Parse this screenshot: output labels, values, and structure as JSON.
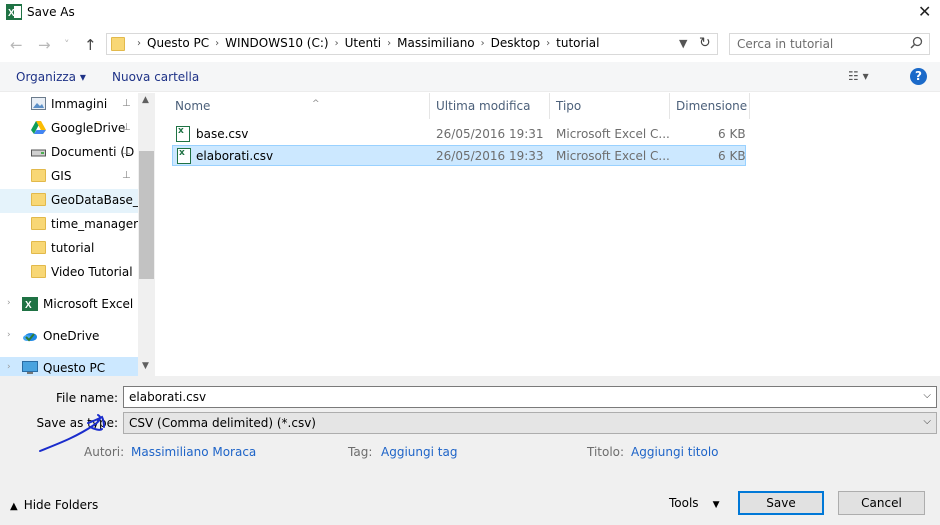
{
  "window": {
    "title": "Save As",
    "close_glyph": "✕"
  },
  "nav": {
    "back_glyph": "←",
    "forward_glyph": "→",
    "recent_glyph": "˅",
    "up_glyph": "↑",
    "breadcrumbs": [
      "Questo PC",
      "WINDOWS10 (C:)",
      "Utenti",
      "Massimiliano",
      "Desktop",
      "tutorial"
    ],
    "search_placeholder": "Cerca in tutorial"
  },
  "toolbar": {
    "organize_label": "Organizza ▾",
    "new_folder_label": "Nuova cartella",
    "view_glyph": "☷ ▾",
    "help_label": "?"
  },
  "navpane": {
    "quick_items": [
      {
        "label": "Immagini",
        "icon": "pictures-icon",
        "pinned": true
      },
      {
        "label": "GoogleDrive",
        "icon": "google-drive-icon",
        "pinned": true
      },
      {
        "label": "Documenti (D",
        "icon": "drive-icon",
        "pinned": true
      },
      {
        "label": "GIS",
        "icon": "folder-icon",
        "pinned": true
      },
      {
        "label": "GeoDataBase_M",
        "icon": "folder-icon",
        "pinned": false,
        "selected": true
      },
      {
        "label": "time_manager",
        "icon": "folder-icon",
        "pinned": false
      },
      {
        "label": "tutorial",
        "icon": "folder-icon",
        "pinned": false
      },
      {
        "label": "Video Tutorial",
        "icon": "folder-icon",
        "pinned": false
      }
    ],
    "roots": [
      {
        "label": "Microsoft Excel",
        "icon": "excel-icon"
      },
      {
        "label": "OneDrive",
        "icon": "onedrive-icon"
      },
      {
        "label": "Questo PC",
        "icon": "computer-icon",
        "selected": true
      }
    ],
    "pin_glyph": "📌"
  },
  "filelist": {
    "columns": [
      "Nome",
      "Ultima modifica",
      "Tipo",
      "Dimensione"
    ],
    "rows": [
      {
        "name": "base.csv",
        "date": "26/05/2016 19:31",
        "type": "Microsoft Excel C...",
        "size": "6 KB",
        "selected": false
      },
      {
        "name": "elaborati.csv",
        "date": "26/05/2016 19:33",
        "type": "Microsoft Excel C...",
        "size": "6 KB",
        "selected": true
      }
    ]
  },
  "form": {
    "file_name_label": "File name:",
    "file_name_value": "elaborati.csv",
    "save_type_label": "Save as type:",
    "save_type_value": "CSV (Comma delimited) (*.csv)",
    "authors_label": "Autori:",
    "authors_value": "Massimiliano Moraca",
    "tag_label": "Tag:",
    "tag_value": "Aggiungi tag",
    "title_label": "Titolo:",
    "title_value": "Aggiungi titolo"
  },
  "footer": {
    "hide_folders_label": "Hide Folders",
    "tools_label": "Tools",
    "save_label": "Save",
    "cancel_label": "Cancel"
  },
  "colors": {
    "accent": "#0078d7",
    "link": "#1e64c8",
    "selection": "#cce8ff",
    "annotation_ink": "#1a2ccc"
  }
}
